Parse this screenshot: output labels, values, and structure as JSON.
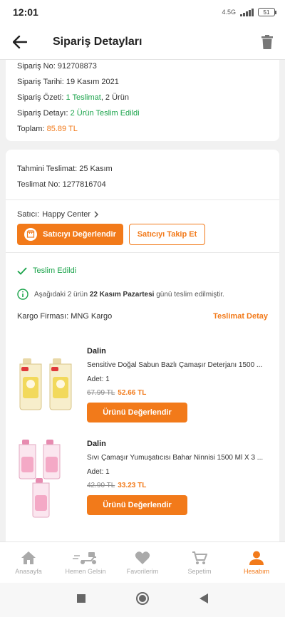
{
  "status_bar": {
    "time": "12:01",
    "network_label": "4.5G",
    "battery": "51"
  },
  "app_bar": {
    "title": "Sipariş Detayları"
  },
  "order_summary": {
    "order_no_label": "Sipariş No:",
    "order_no": "912708873",
    "order_date_label": "Sipariş Tarihi:",
    "order_date": "19 Kasım 2021",
    "summary_label": "Sipariş Özeti:",
    "summary_delivery": "1 Teslimat",
    "summary_items": ", 2 Ürün",
    "detail_label": "Sipariş Detayı:",
    "detail_value": "2 Ürün Teslim Edildi",
    "total_label": "Toplam:",
    "total_value": "85.89 TL"
  },
  "delivery": {
    "estimated_label": "Tahmini Teslimat:",
    "estimated_value": "25 Kasım",
    "delivery_no_label": "Teslimat No:",
    "delivery_no": "1277816704"
  },
  "seller": {
    "label": "Satıcı:",
    "name": "Happy Center",
    "rate_button": "Satıcıyı Değerlendir",
    "follow_button": "Satıcıyı Takip Et"
  },
  "shipment": {
    "status": "Teslim Edildi",
    "info_prefix": "Aşağıdaki 2 ürün ",
    "info_date": "22 Kasım Pazartesi",
    "info_suffix": " günü teslim edilmiştir.",
    "cargo_label": "Kargo Firması:",
    "cargo_name": "MNG Kargo",
    "delivery_detail_link": "Teslimat Detay"
  },
  "products": [
    {
      "brand": "Dalin",
      "name": "Sensitive Doğal Sabun Bazlı Çamaşır Deterjanı 1500 ...",
      "qty": "Adet: 1",
      "old_price": "67.99 TL",
      "new_price": "52.66 TL",
      "button": "Ürünü Değerlendir"
    },
    {
      "brand": "Dalin",
      "name": "Sıvı Çamaşır Yumuşatıcısı Bahar Ninnisi 1500 Ml X 3 ...",
      "qty": "Adet: 1",
      "old_price": "42.90 TL",
      "new_price": "33.23 TL",
      "button": "Ürünü Değerlendir"
    }
  ],
  "bottom_nav": [
    {
      "label": "Anasayfa",
      "icon": "home-icon",
      "active": false
    },
    {
      "label": "Hemen Gelsin",
      "icon": "scooter-icon",
      "active": false
    },
    {
      "label": "Favorilerim",
      "icon": "heart-icon",
      "active": false
    },
    {
      "label": "Sepetim",
      "icon": "cart-icon",
      "active": false
    },
    {
      "label": "Hesabım",
      "icon": "user-icon",
      "active": true
    }
  ],
  "colors": {
    "accent": "#f27a1a",
    "success": "#1aa34a"
  }
}
